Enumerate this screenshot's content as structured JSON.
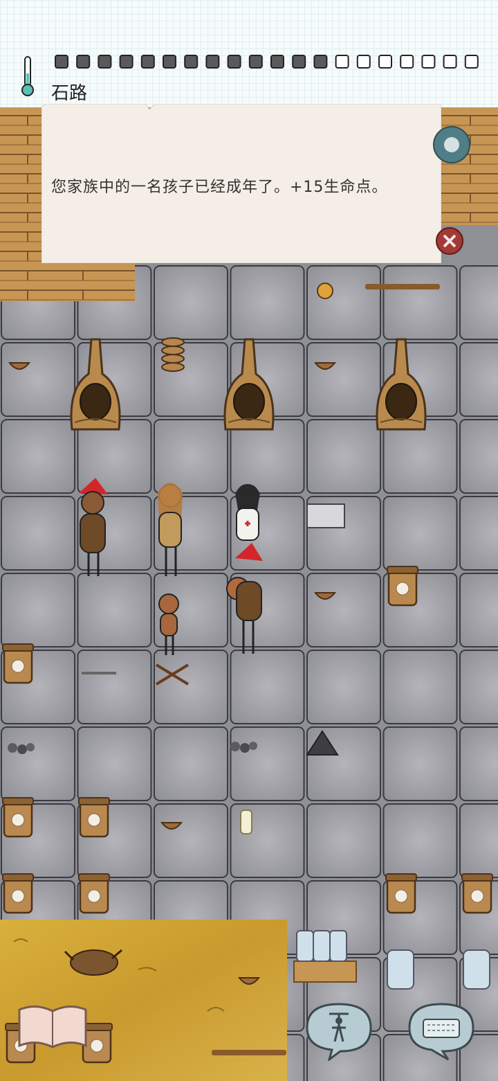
{
  "hud": {
    "location_name": "石路",
    "food_pips_total": 20,
    "food_pips_filled": 13,
    "icons": [
      "thermometer-icon",
      "food-pip-icon"
    ]
  },
  "notice": {
    "message": "您家族中的一名孩子已经成年了。+15生命点。"
  },
  "controls": {
    "settings": "gear-icon",
    "close": "close-icon",
    "tech_book": "open-book-icon",
    "emote": "puppet-icon",
    "chat": "keyboard-icon"
  },
  "colors": {
    "floor": "#a8a8ae",
    "grass": "#d4a93a",
    "wood": "#c99a5a",
    "paper": "#f3ece3",
    "close_red": "#a43a35",
    "gear_teal": "#4f7e86"
  }
}
